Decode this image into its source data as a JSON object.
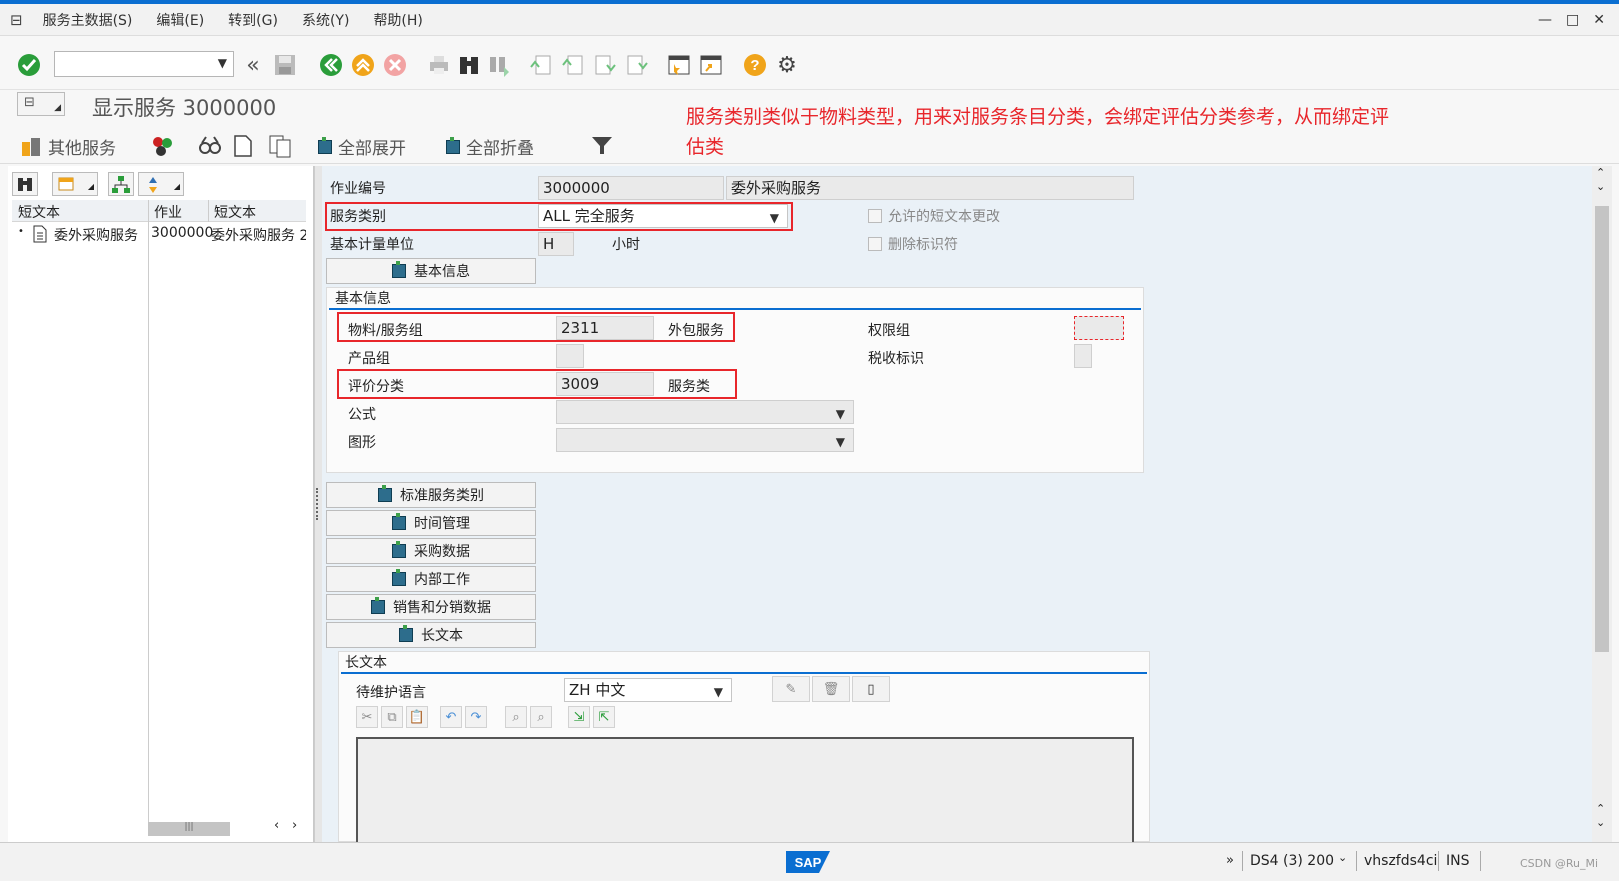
{
  "menu": {
    "items": [
      "服务主数据(S)",
      "编辑(E)",
      "转到(G)",
      "系统(Y)",
      "帮助(H)"
    ]
  },
  "window_controls": [
    "—",
    "□",
    "✕"
  ],
  "toolbar": {
    "command_value": "",
    "icons": [
      "enter-icon",
      "command-field",
      "collapse-icon",
      "save-icon",
      "back-icon",
      "exit-icon",
      "cancel-icon",
      "print-icon",
      "find-icon",
      "find-next-icon",
      "first-page-icon",
      "previous-page-icon",
      "next-page-icon",
      "last-page-icon",
      "create-session-icon",
      "shortcut-icon",
      "help-icon",
      "settings-icon"
    ]
  },
  "title": {
    "text": "显示服务 3000000"
  },
  "annotation": {
    "text": "服务类别类似于物料类型，用来对服务条目分类，会绑定评估分类参考，从而绑定评估类"
  },
  "app_toolbar": {
    "other_services": "其他服务",
    "expand_all": "全部展开",
    "collapse_all": "全部折叠"
  },
  "left_tree": {
    "columns": [
      "短文本",
      "作业",
      "短文本"
    ],
    "rows": [
      {
        "short_text": "委外采购服务",
        "activity": "3000000",
        "short_text2": "委外采购服务 2"
      }
    ]
  },
  "header_fields": {
    "activity_no_label": "作业编号",
    "activity_no": "3000000",
    "activity_desc": "委外采购服务",
    "service_category_label": "服务类别",
    "service_category": "ALL 完全服务",
    "base_uom_label": "基本计量单位",
    "base_uom": "H",
    "base_uom_desc": "小时",
    "allow_short_text_change": "允许的短文本更改",
    "deletion_flag": "删除标识符"
  },
  "basic_info": {
    "tab_button": "基本信息",
    "group_title": "基本信息",
    "material_group_label": "物料/服务组",
    "material_group": "2311",
    "material_group_desc": "外包服务",
    "product_group_label": "产品组",
    "product_group": "",
    "valuation_class_label": "评价分类",
    "valuation_class": "3009",
    "valuation_class_desc": "服务类",
    "formula_label": "公式",
    "formula": "",
    "graphic_label": "图形",
    "graphic": "",
    "authorization_group_label": "权限组",
    "authorization_group": "",
    "tax_indicator_label": "税收标识",
    "tax_indicator": ""
  },
  "section_buttons": [
    "标准服务类别",
    "时间管理",
    "采购数据",
    "内部工作",
    "销售和分销数据",
    "长文本"
  ],
  "long_text": {
    "group_title": "长文本",
    "language_label": "待维护语言",
    "language": "ZH 中文"
  },
  "status_bar": {
    "system": "DS4 (3) 200",
    "host": "vhszfds4ci",
    "mode": "INS",
    "watermark": "CSDN @Ru_Mi"
  },
  "colors": {
    "accent": "#0a6ed1",
    "annotation_red": "#e8262b"
  }
}
